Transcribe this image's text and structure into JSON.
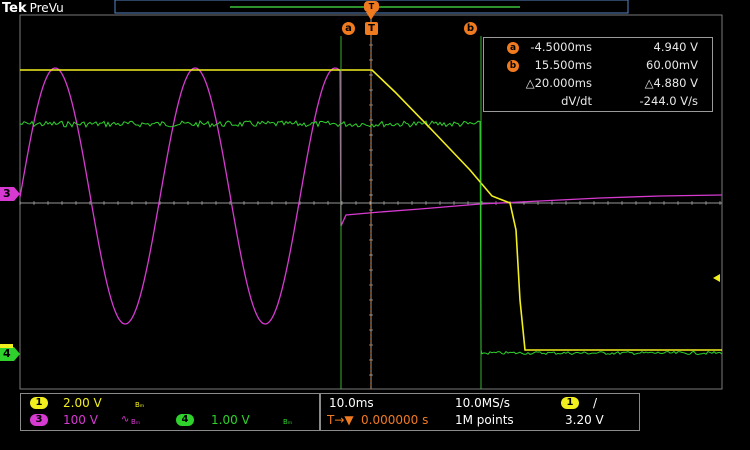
{
  "brand": {
    "name": "Tek",
    "mode": "PreVu"
  },
  "colors": {
    "ch1": "#f2ef1e",
    "ch3": "#d63ad0",
    "ch4": "#2fd12c",
    "cursor": "#f07a20",
    "grid": "#c8c8c8"
  },
  "markers": {
    "cursor_a": "a",
    "cursor_b": "b",
    "trigger": "T"
  },
  "cursor_readout": {
    "a": {
      "label": "a",
      "time": "-4.5000ms",
      "value": "4.940 V"
    },
    "b": {
      "label": "b",
      "time": "15.500ms",
      "value": "60.00mV"
    },
    "delta": {
      "time": "△20.000ms",
      "value": "△4.880 V"
    },
    "slope": {
      "label": "dV/dt",
      "value": "-244.0 V/s"
    }
  },
  "channels": {
    "ch1": {
      "num": "1",
      "scale": "2.00 V",
      "bw": "Bₘ"
    },
    "ch3": {
      "num": "3",
      "scale": "100 V",
      "coupling": "∿",
      "bw": "Bₘ"
    },
    "ch4": {
      "num": "4",
      "scale": "1.00 V",
      "bw": "Bₘ"
    }
  },
  "timebase": {
    "scale": "10.0ms",
    "sample_rate": "10.0MS/s",
    "trigger_delay": "0.000000 s",
    "record_length": "1M points",
    "trigger_channel": "1",
    "trigger_slope": "/",
    "trigger_level": "3.20 V"
  },
  "side_labels": {
    "ch3": "3",
    "ch4": "4"
  }
}
